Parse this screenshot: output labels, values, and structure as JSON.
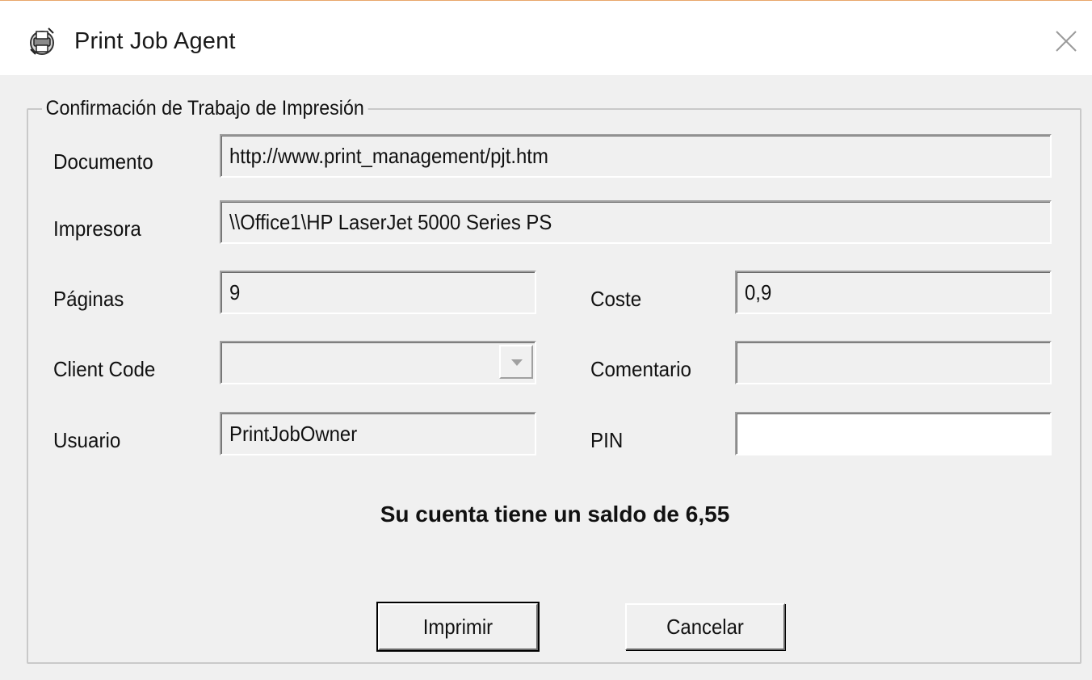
{
  "window": {
    "title": "Print Job Agent",
    "close_icon": "close-icon",
    "app_icon": "printer-agent-icon"
  },
  "group": {
    "legend": "Confirmación de Trabajo de Impresión"
  },
  "fields": {
    "documento": {
      "label": "Documento",
      "value": "http://www.print_management/pjt.htm"
    },
    "impresora": {
      "label": "Impresora",
      "value": "\\\\Office1\\HP LaserJet 5000 Series PS"
    },
    "paginas": {
      "label": "Páginas",
      "value": "9"
    },
    "coste": {
      "label": "Coste",
      "value": "0,9"
    },
    "client_code": {
      "label": "Client Code",
      "value": ""
    },
    "comentario": {
      "label": "Comentario",
      "value": ""
    },
    "usuario": {
      "label": "Usuario",
      "value": "PrintJobOwner"
    },
    "pin": {
      "label": "PIN",
      "value": ""
    }
  },
  "balance_text": "Su cuenta tiene un saldo de 6,55",
  "buttons": {
    "print": "Imprimir",
    "cancel": "Cancelar"
  },
  "colors": {
    "dialog_bg": "#f0f0f0",
    "titlebar_bg": "#ffffff",
    "window_border": "#e8a76a"
  }
}
